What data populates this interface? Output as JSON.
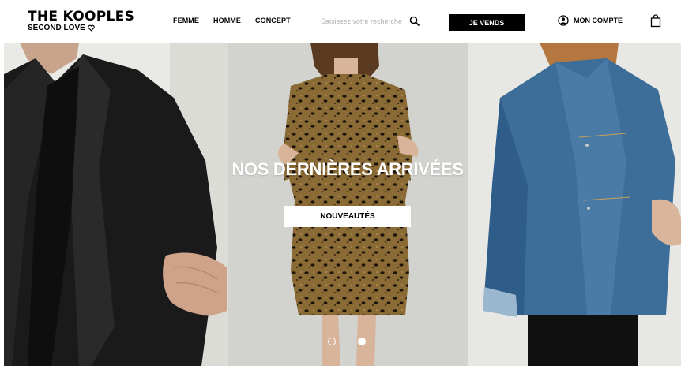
{
  "brand": {
    "name": "THE KOOPLES",
    "tagline": "SECOND LOVE"
  },
  "nav": {
    "items": [
      {
        "label": "FEMME"
      },
      {
        "label": "HOMME"
      },
      {
        "label": "CONCEPT"
      }
    ]
  },
  "search": {
    "placeholder": "Saisissez votre recherche",
    "icon": "search-icon"
  },
  "header": {
    "sell_label": "JE VENDS",
    "account_label": "MON COMPTE",
    "account_icon": "user-circle-icon",
    "bag_icon": "shopping-bag-icon"
  },
  "hero": {
    "title": "NOS DERNIÈRES ARRIVÉES",
    "cta_label": "NOUVEAUTÉS",
    "slides": 2,
    "active_slide": 2
  },
  "colors": {
    "primary": "#000000",
    "background": "#ffffff",
    "cta_text": "#ffffff"
  }
}
